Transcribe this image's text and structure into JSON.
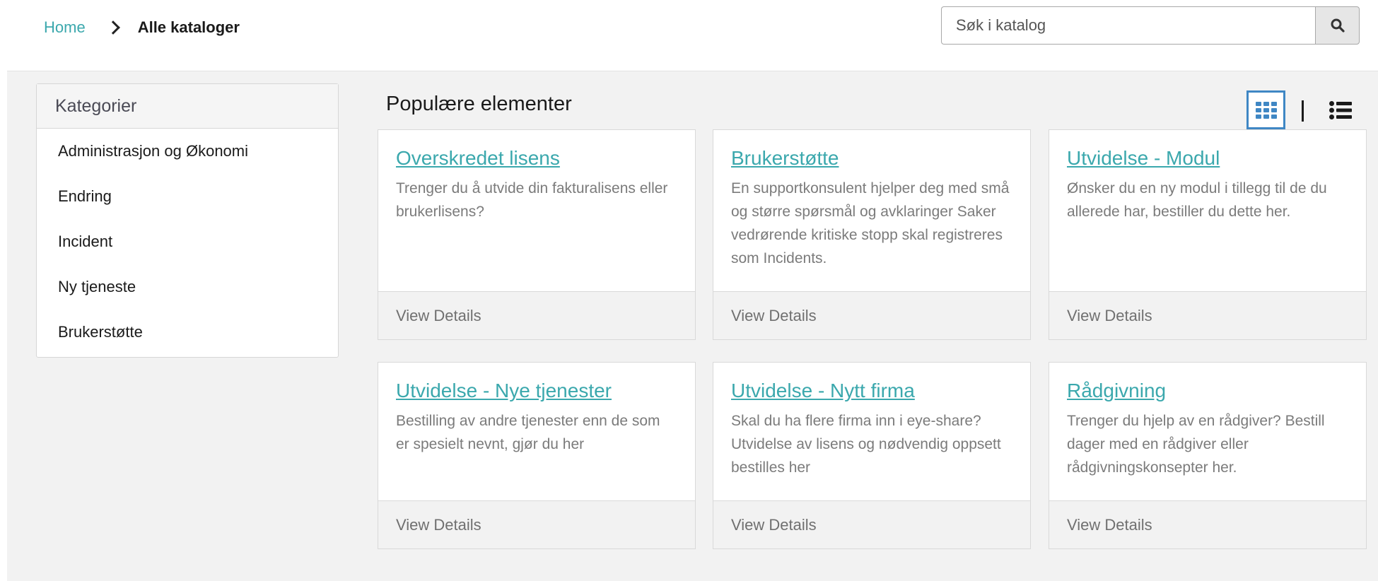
{
  "breadcrumb": {
    "home": "Home",
    "current": "Alle kataloger"
  },
  "search": {
    "placeholder": "Søk i katalog",
    "icon": "search-icon"
  },
  "sidebar": {
    "title": "Kategorier",
    "items": [
      {
        "label": "Administrasjon og Økonomi"
      },
      {
        "label": "Endring"
      },
      {
        "label": "Incident"
      },
      {
        "label": "Ny tjeneste"
      },
      {
        "label": "Brukerstøtte"
      }
    ]
  },
  "main": {
    "title": "Populære elementer",
    "view_toggle": {
      "grid_icon": "grid-view-icon",
      "list_icon": "list-view-icon",
      "active": "grid",
      "accent_color": "#3f87c4"
    },
    "cards": [
      {
        "title": "Overskredet lisens",
        "description": "Trenger du å utvide din fakturalisens eller brukerlisens?",
        "action": "View Details"
      },
      {
        "title": "Brukerstøtte",
        "description": "En supportkonsulent hjelper deg med små og større spørsmål og avklaringer Saker vedrørende kritiske stopp skal registreres som Incidents.",
        "action": "View Details"
      },
      {
        "title": "Utvidelse - Modul",
        "description": "Ønsker du en ny modul i tillegg til de du allerede har, bestiller du dette her.",
        "action": "View Details"
      },
      {
        "title": "Utvidelse - Nye tjenester",
        "description": "Bestilling av andre tjenester enn de som er spesielt nevnt, gjør du her",
        "action": "View Details"
      },
      {
        "title": "Utvidelse - Nytt firma",
        "description": "Skal du ha flere firma inn i eye-share? Utvidelse av lisens og nødvendig oppsett bestilles her",
        "action": "View Details"
      },
      {
        "title": "Rådgivning",
        "description": "Trenger du hjelp av en rådgiver? Bestill dager med en rådgiver eller rådgivningskonsepter her.",
        "action": "View Details"
      }
    ]
  },
  "colors": {
    "link": "#3ba8ad",
    "content_background": "#f2f2f2"
  }
}
